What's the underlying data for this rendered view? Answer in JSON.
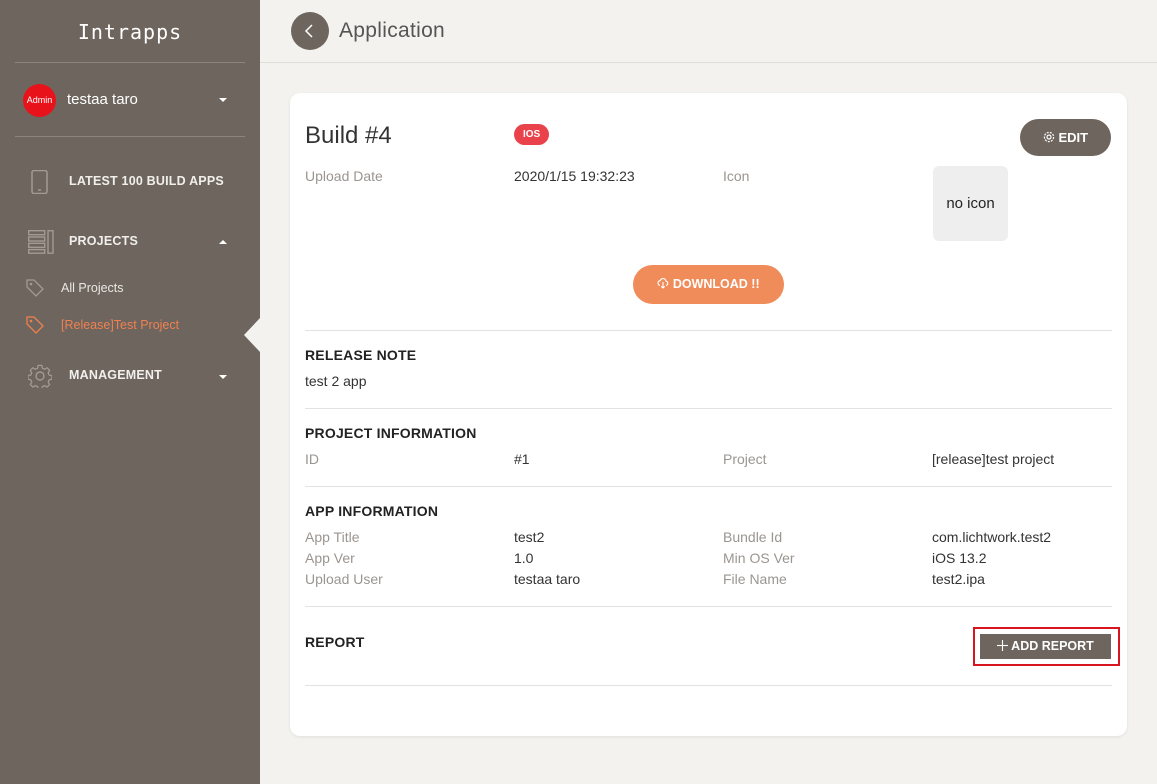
{
  "sidebar": {
    "brand": "Intrapps",
    "user": {
      "avatar_label": "Admin",
      "name": "testaa taro"
    },
    "nav": {
      "latest": "LATEST 100 BUILD APPS",
      "projects": "PROJECTS",
      "projects_children": [
        "All Projects",
        "[Release]Test Project"
      ],
      "management": "MANAGEMENT"
    },
    "active_color": "#f08050"
  },
  "header": {
    "title": "Application"
  },
  "build": {
    "title": "Build #4",
    "platform_badge": "IOS",
    "edit_label": "EDIT",
    "upload_date_label": "Upload Date",
    "upload_date_value": "2020/1/15 19:32:23",
    "icon_label": "Icon",
    "icon_placeholder": "no icon",
    "download_label": "DOWNLOAD !!"
  },
  "release_note": {
    "title": "RELEASE NOTE",
    "text": "test 2 app"
  },
  "project_info": {
    "title": "PROJECT INFORMATION",
    "id_label": "ID",
    "id_value": "#1",
    "project_label": "Project",
    "project_value": "[release]test project"
  },
  "app_info": {
    "title": "APP INFORMATION",
    "rows": [
      {
        "l1": "App Title",
        "v1": "test2",
        "l2": "Bundle Id",
        "v2": "com.lichtwork.test2"
      },
      {
        "l1": "App Ver",
        "v1": "1.0",
        "l2": "Min OS Ver",
        "v2": "iOS 13.2"
      },
      {
        "l1": "Upload User",
        "v1": "testaa taro",
        "l2": "File Name",
        "v2": "test2.ipa"
      }
    ]
  },
  "report": {
    "title": "REPORT",
    "add_label": "ADD REPORT"
  },
  "colors": {
    "sidebar_bg": "#6e665e",
    "accent": "#f08b5a",
    "badge": "#e9424b"
  }
}
